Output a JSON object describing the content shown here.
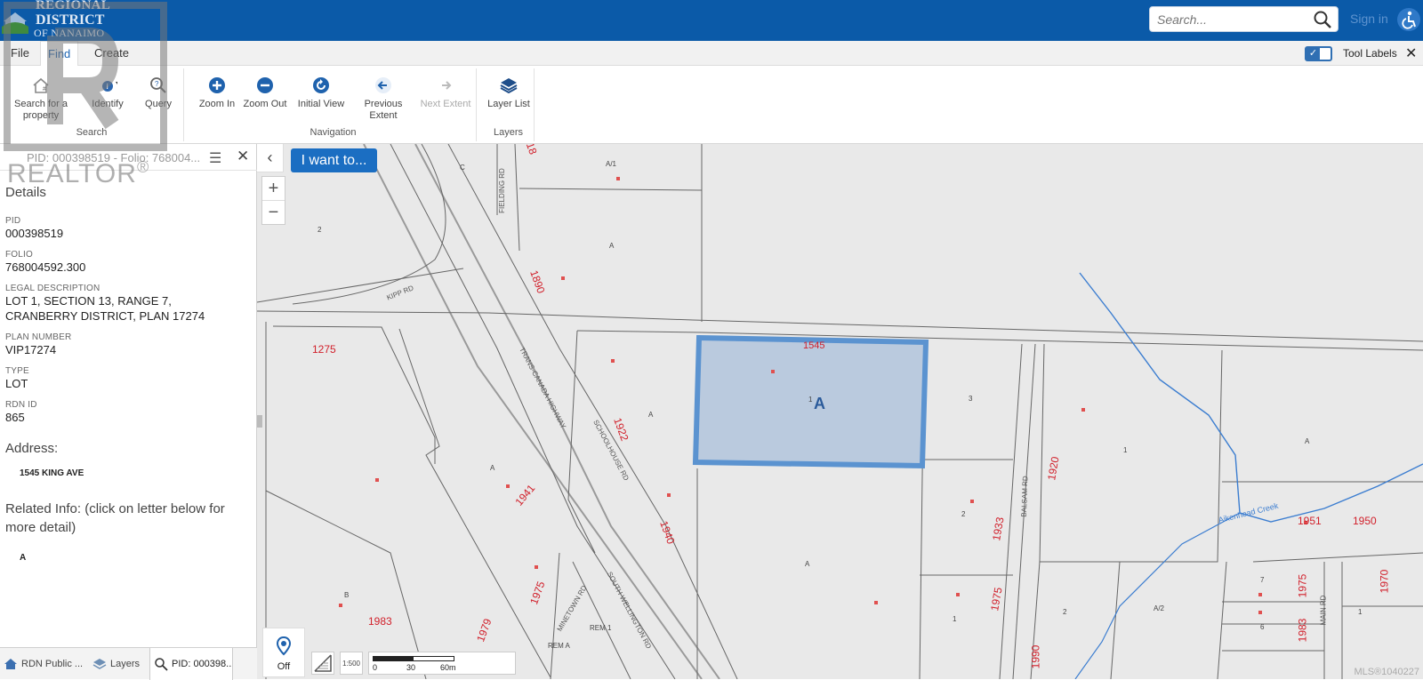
{
  "header": {
    "logo": {
      "line1": "REGIONAL",
      "line2": "DISTRICT",
      "line3": "OF NANAIMO"
    },
    "search_placeholder": "Search...",
    "sign_in": "Sign in",
    "accessibility_icon": "accessibility-icon"
  },
  "tabs": [
    {
      "label": "File",
      "active": false
    },
    {
      "label": "Find",
      "active": true
    },
    {
      "label": "Create",
      "active": false
    }
  ],
  "tool_labels": {
    "label": "Tool Labels",
    "checked": true
  },
  "ribbon": {
    "groups": [
      {
        "label": "Search",
        "buttons": [
          {
            "label": "Search for a property",
            "icon": "house-search-icon"
          },
          {
            "label": "Identify",
            "icon": "identify-icon"
          },
          {
            "label": "Query",
            "icon": "magnifier-icon"
          }
        ]
      },
      {
        "label": "Navigation",
        "buttons": [
          {
            "label": "Zoom In",
            "icon": "zoom-in-icon"
          },
          {
            "label": "Zoom Out",
            "icon": "zoom-out-icon"
          },
          {
            "label": "Initial View",
            "icon": "refresh-icon"
          },
          {
            "label": "Previous Extent",
            "icon": "back-arrow-icon"
          },
          {
            "label": "Next Extent",
            "icon": "forward-arrow-icon",
            "disabled": true
          }
        ]
      },
      {
        "label": "Layers",
        "buttons": [
          {
            "label": "Layer List",
            "icon": "layers-icon"
          }
        ]
      }
    ]
  },
  "panel": {
    "title": "PID: 000398519 - Folio: 768004...",
    "section": "Details",
    "fields": [
      {
        "label": "PID",
        "value": "000398519"
      },
      {
        "label": "FOLIO",
        "value": "768004592.300"
      },
      {
        "label": "LEGAL DESCRIPTION",
        "value": "LOT 1, SECTION 13, RANGE 7, CRANBERRY DISTRICT, PLAN 17274"
      },
      {
        "label": "PLAN NUMBER",
        "value": "VIP17274"
      },
      {
        "label": "TYPE",
        "value": "LOT"
      },
      {
        "label": "RDN ID",
        "value": "865"
      }
    ],
    "address_header": "Address:",
    "address": "1545 KING AVE",
    "related_header": "Related Info: (click on letter below for more detail)",
    "related_link": "A"
  },
  "watermark": {
    "text": "REALTOR",
    "mark": "®"
  },
  "bottom_tabs": [
    {
      "label": "RDN Public ...",
      "icon": "house-icon",
      "active": false
    },
    {
      "label": "Layers",
      "icon": "layers-icon",
      "active": false
    },
    {
      "label": "PID: 000398...",
      "icon": "details-search-icon",
      "active": true
    }
  ],
  "map": {
    "i_want_to": "I want to...",
    "gps_label": "Off",
    "scale_marker_label": "1:500",
    "scale": [
      "0",
      "30",
      "60m"
    ],
    "highlight_lot_label": "A",
    "creek_label": "Aikenhead Creek",
    "roads": [
      "KIPP RD",
      "FIELDING RD",
      "TRANS-CANADA HIGHWAY",
      "SCHOOLHOUSE RD",
      "BALSAM RD",
      "MINETOWN RD",
      "SOUTH WELLINGTON RD",
      "MAIN RD"
    ],
    "civic_numbers": [
      "1545",
      "1275",
      "1890",
      "1922",
      "1941",
      "1940",
      "1920",
      "1933",
      "1951",
      "1950",
      "1975",
      "1983",
      "1975",
      "1979",
      "1970",
      "1975",
      "1983",
      "1990",
      "18",
      "1978",
      "1985",
      "89"
    ],
    "lot_letters": [
      "C",
      "A/1",
      "2",
      "A",
      "A",
      "A",
      "B",
      "1",
      "3",
      "A",
      "1",
      "A",
      "2",
      "1",
      "2",
      "A/2",
      "7",
      "6",
      "5",
      "1",
      "REM 1",
      "REM A",
      "A"
    ],
    "mls": "MLS®1040227"
  },
  "colors": {
    "header_blue": "#0b5aa8",
    "accent": "#1b6ec2",
    "highlight_fill": "#a9bfd9",
    "highlight_stroke": "#5b93d0",
    "civic_red": "#d11f2a",
    "creek_blue": "#3b7dd0"
  }
}
